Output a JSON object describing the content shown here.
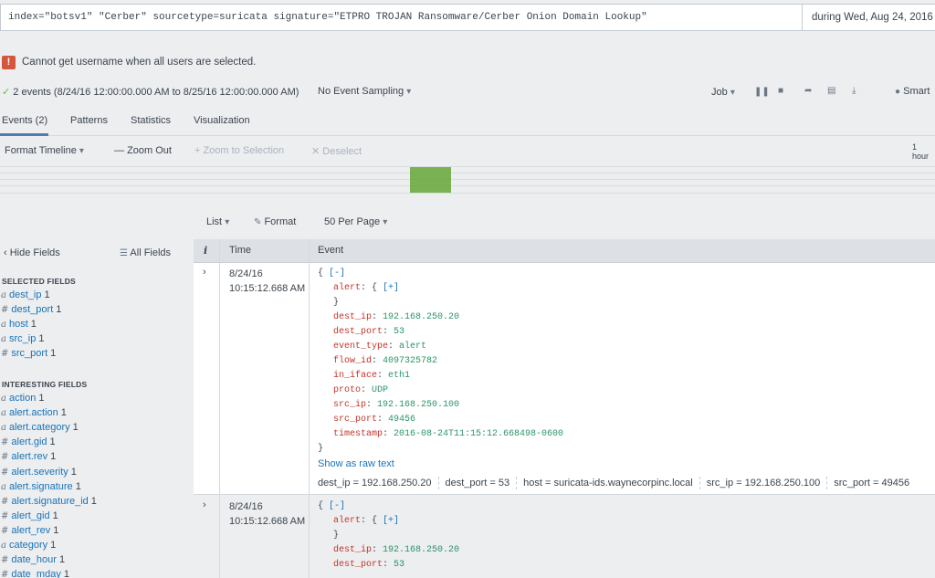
{
  "search": {
    "query": "index=\"botsv1\" \"Cerber\" sourcetype=suricata signature=\"ETPRO TROJAN Ransomware/Cerber Onion Domain Lookup\"",
    "time_range": "during Wed, Aug 24, 2016"
  },
  "error": {
    "icon": "!",
    "message": "Cannot get username when all users are selected."
  },
  "job_bar": {
    "status": "2 events (8/24/16 12:00:00.000 AM to 8/25/16 12:00:00.000 AM)",
    "sampling": "No Event Sampling",
    "job": "Job",
    "mode": "Smart"
  },
  "tabs": [
    "Events (2)",
    "Patterns",
    "Statistics",
    "Visualization"
  ],
  "timeline": {
    "format": "Format Timeline",
    "zoom_out": "Zoom Out",
    "zoom_selection": "+ Zoom to Selection",
    "deselect": "Deselect",
    "scale": "1 hour"
  },
  "list_controls": {
    "list": "List",
    "format": "Format",
    "per_page": "50 Per Page"
  },
  "sidebar": {
    "hide_fields": "Hide Fields",
    "all_fields": "All Fields",
    "selected_title": "SELECTED FIELDS",
    "selected": [
      {
        "type": "a",
        "name": "dest_ip",
        "count": "1"
      },
      {
        "type": "#",
        "name": "dest_port",
        "count": "1"
      },
      {
        "type": "a",
        "name": "host",
        "count": "1"
      },
      {
        "type": "a",
        "name": "src_ip",
        "count": "1"
      },
      {
        "type": "#",
        "name": "src_port",
        "count": "1"
      }
    ],
    "interesting_title": "INTERESTING FIELDS",
    "interesting": [
      {
        "type": "a",
        "name": "action",
        "count": "1"
      },
      {
        "type": "a",
        "name": "alert.action",
        "count": "1"
      },
      {
        "type": "a",
        "name": "alert.category",
        "count": "1"
      },
      {
        "type": "#",
        "name": "alert.gid",
        "count": "1"
      },
      {
        "type": "#",
        "name": "alert.rev",
        "count": "1"
      },
      {
        "type": "#",
        "name": "alert.severity",
        "count": "1"
      },
      {
        "type": "a",
        "name": "alert.signature",
        "count": "1"
      },
      {
        "type": "#",
        "name": "alert.signature_id",
        "count": "1"
      },
      {
        "type": "#",
        "name": "alert_gid",
        "count": "1"
      },
      {
        "type": "#",
        "name": "alert_rev",
        "count": "1"
      },
      {
        "type": "a",
        "name": "category",
        "count": "1"
      },
      {
        "type": "#",
        "name": "date_hour",
        "count": "1"
      },
      {
        "type": "#",
        "name": "date_mday",
        "count": "1"
      }
    ]
  },
  "table": {
    "col_info": "i",
    "col_time": "Time",
    "col_event": "Event"
  },
  "events": [
    {
      "date": "8/24/16",
      "time": "10:15:12.668 AM",
      "open": "{ [-]",
      "alert_key": "alert",
      "alert_val": "{ [+]",
      "alert_close": "}",
      "fields": [
        {
          "k": "dest_ip",
          "v": "192.168.250.20"
        },
        {
          "k": "dest_port",
          "v": "53"
        },
        {
          "k": "event_type",
          "v": "alert"
        },
        {
          "k": "flow_id",
          "v": "4097325782"
        },
        {
          "k": "in_iface",
          "v": "eth1"
        },
        {
          "k": "proto",
          "v": "UDP"
        },
        {
          "k": "src_ip",
          "v": "192.168.250.100"
        },
        {
          "k": "src_port",
          "v": "49456"
        },
        {
          "k": "timestamp",
          "v": "2016-08-24T11:15:12.668498-0600"
        }
      ],
      "close": "}",
      "raw_link": "Show as raw text",
      "kv": [
        {
          "k": "dest_ip",
          "v": "192.168.250.20"
        },
        {
          "k": "dest_port",
          "v": "53"
        },
        {
          "k": "host",
          "v": "suricata-ids.waynecorpinc.local"
        },
        {
          "k": "src_ip",
          "v": "192.168.250.100"
        },
        {
          "k": "src_port",
          "v": "49456"
        }
      ]
    },
    {
      "date": "8/24/16",
      "time": "10:15:12.668 AM",
      "open": "{ [-]",
      "alert_key": "alert",
      "alert_val": "{ [+]",
      "alert_close": "}",
      "fields": [
        {
          "k": "dest_ip",
          "v": "192.168.250.20"
        },
        {
          "k": "dest_port",
          "v": "53"
        }
      ]
    }
  ]
}
